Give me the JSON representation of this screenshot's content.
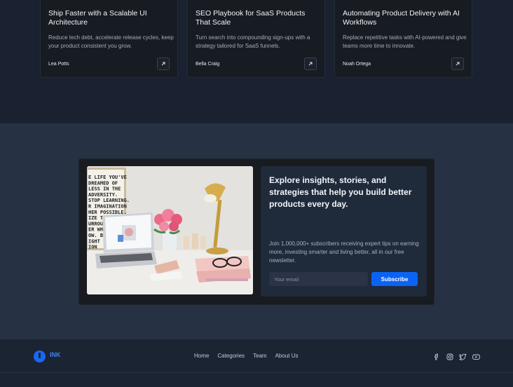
{
  "cards": [
    {
      "title": "Ship Faster with a Scalable UI Architecture",
      "description": "Reduce tech debt, accelerate release cycles, keep your product consistent you grow.",
      "author": "Lea Potts"
    },
    {
      "title": "SEO Playbook for SaaS Products That Scale",
      "description": "Turn search into compounding sign-ups with a strategy tailored for SaaS funnels.",
      "author": "Bella Craig"
    },
    {
      "title": "Automating Product Delivery with AI Workflows",
      "description": "Replace repetitive tasks with AI-powered and give teams more time to innovate.",
      "author": "Noah Ortega"
    }
  ],
  "newsletter": {
    "heading": "Explore insights, stories, and strategies that help you build better products every day.",
    "body": "Join 1,000,000+ subscribers receiving expert tips on earning more, investing smarter and living better, all in our free newsletter.",
    "email_placeholder": "Your email",
    "subscribe_label": "Subscribe",
    "poster_lines": [
      "E LIFE YOU'VE",
      "DREAMED OF",
      "LESS IN THE",
      "ADVERSITY.",
      "STOP LEARNING.",
      "R IMAGINATION",
      "HER POSSIBLE.",
      "IZE THE   AUTY",
      "URROUND",
      "ER WHI",
      "OW. BU",
      "IGHT OF",
      "ION"
    ]
  },
  "footer": {
    "brand": "INK",
    "nav": [
      "Home",
      "Categories",
      "Team",
      "About Us"
    ]
  },
  "colors": {
    "accent": "#0b63f3",
    "background": "#1b2433"
  }
}
